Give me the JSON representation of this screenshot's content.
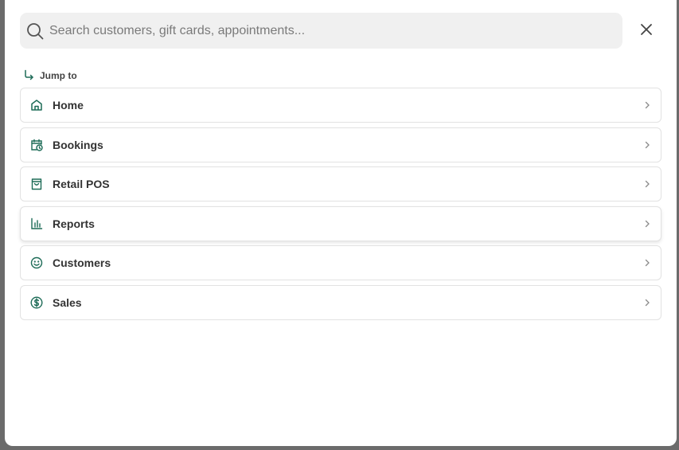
{
  "search": {
    "placeholder": "Search customers, gift cards, appointments...",
    "value": ""
  },
  "jump_to": {
    "label": "Jump to"
  },
  "items": [
    {
      "label": "Home",
      "icon": "home-icon"
    },
    {
      "label": "Bookings",
      "icon": "calendar-clock-icon"
    },
    {
      "label": "Retail POS",
      "icon": "shopping-bag-icon"
    },
    {
      "label": "Reports",
      "icon": "bar-chart-icon"
    },
    {
      "label": "Customers",
      "icon": "smiley-icon"
    },
    {
      "label": "Sales",
      "icon": "dollar-circle-icon"
    }
  ],
  "colors": {
    "accent": "#1d6b57",
    "chevron": "#8a8a8a",
    "overlay": "#6b6b6b"
  }
}
